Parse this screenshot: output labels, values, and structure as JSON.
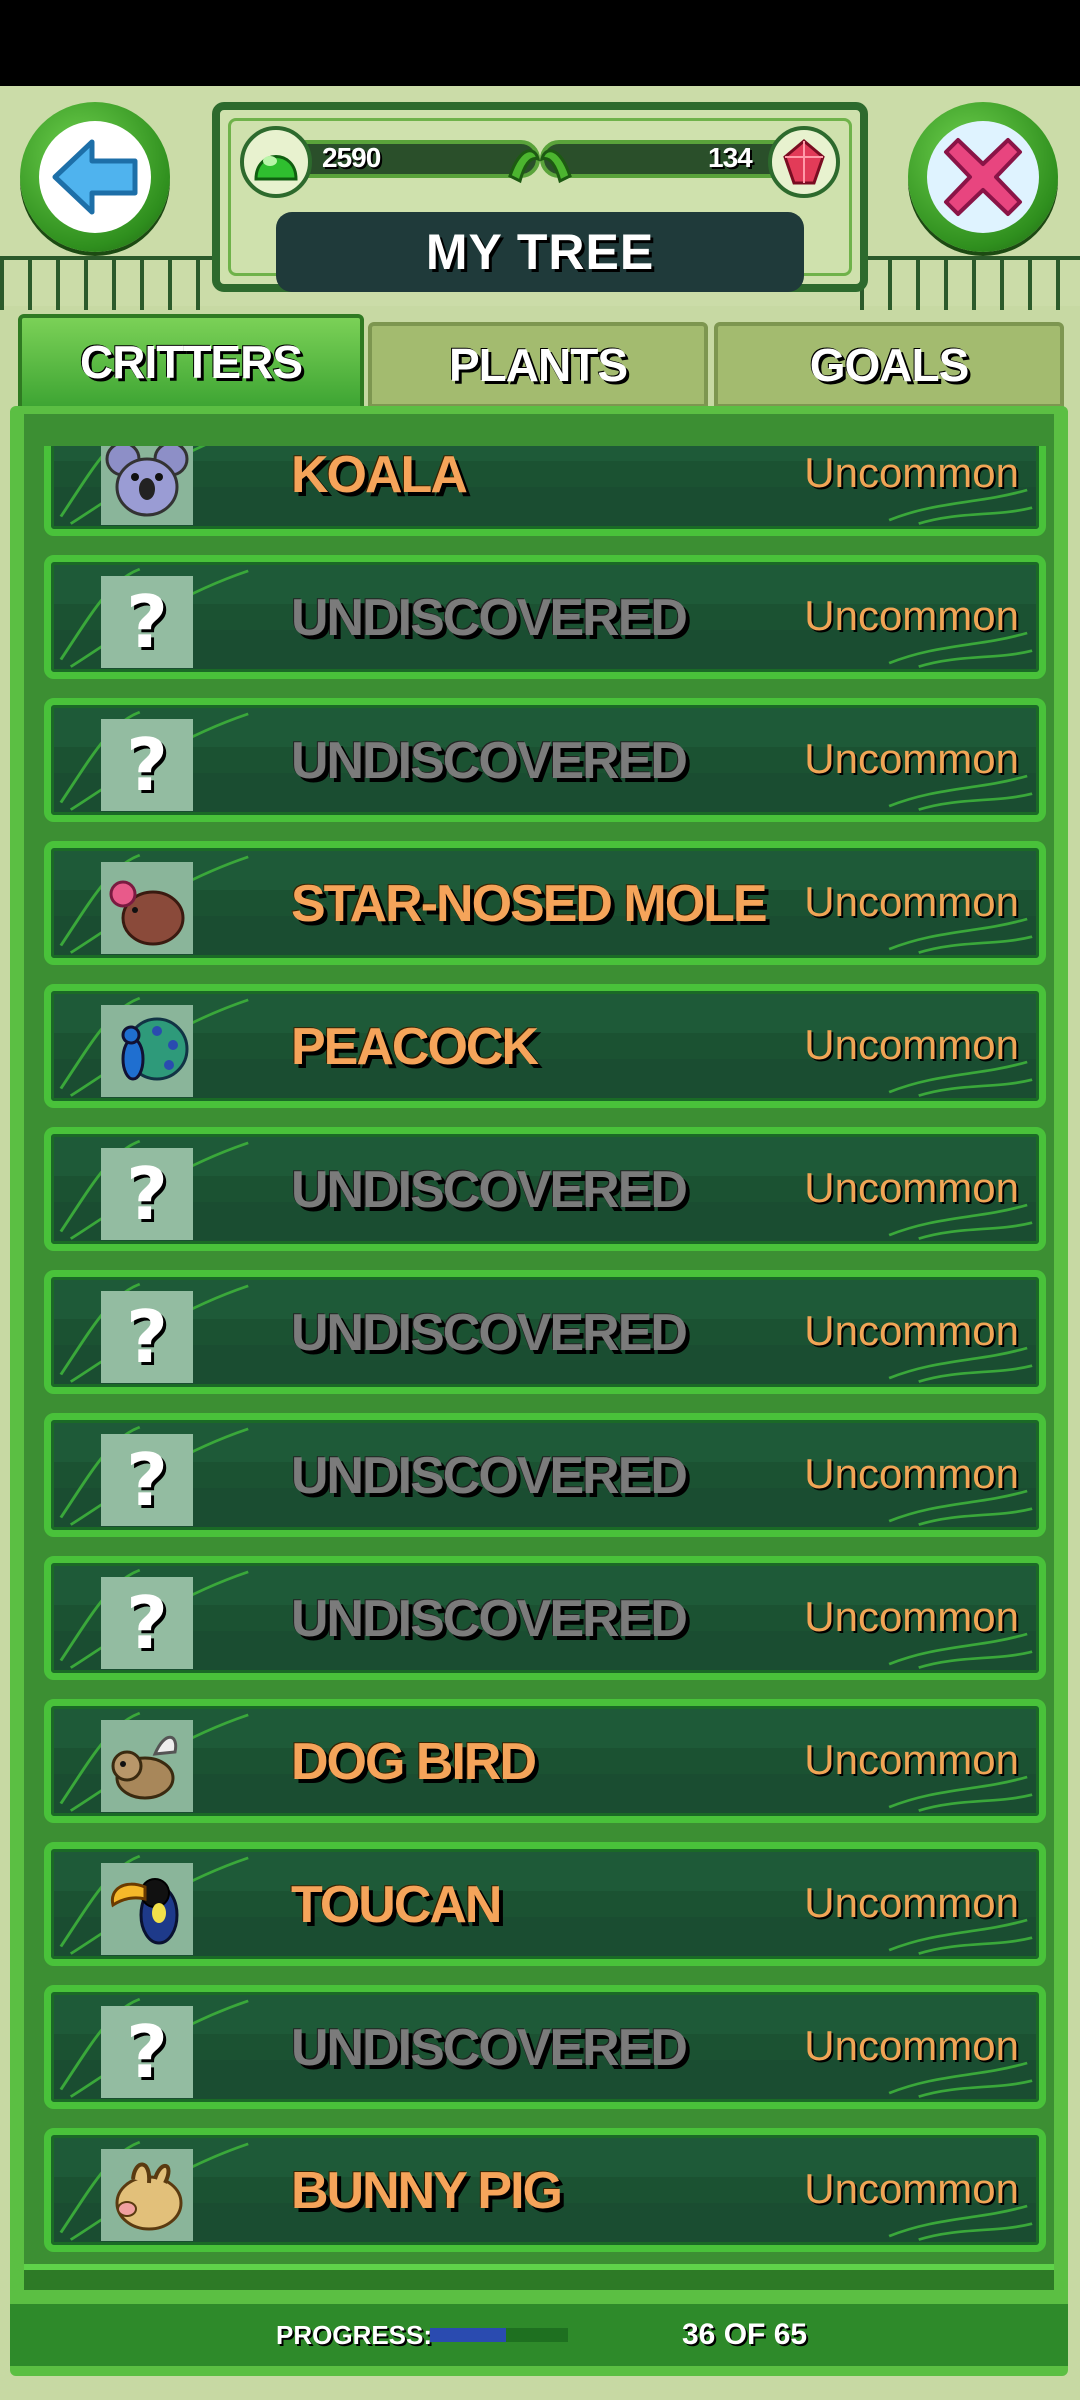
{
  "header": {
    "title": "MY TREE",
    "currency": {
      "gems_green": "2590",
      "gems_red": "134"
    }
  },
  "tabs": [
    {
      "label": "CRITTERS",
      "active": true
    },
    {
      "label": "PLANTS",
      "active": false
    },
    {
      "label": "GOALS",
      "active": false
    }
  ],
  "critters": [
    {
      "name": "KOALA",
      "rarity": "Uncommon",
      "icon": "koala-icon",
      "discovered": true
    },
    {
      "name": "UNDISCOVERED",
      "rarity": "Uncommon",
      "icon": "question-mark-icon",
      "discovered": false
    },
    {
      "name": "UNDISCOVERED",
      "rarity": "Uncommon",
      "icon": "question-mark-icon",
      "discovered": false
    },
    {
      "name": "STAR-NOSED MOLE",
      "rarity": "Uncommon",
      "icon": "star-nosed-mole-icon",
      "discovered": true
    },
    {
      "name": "PEACOCK",
      "rarity": "Uncommon",
      "icon": "peacock-icon",
      "discovered": true
    },
    {
      "name": "UNDISCOVERED",
      "rarity": "Uncommon",
      "icon": "question-mark-icon",
      "discovered": false
    },
    {
      "name": "UNDISCOVERED",
      "rarity": "Uncommon",
      "icon": "question-mark-icon",
      "discovered": false
    },
    {
      "name": "UNDISCOVERED",
      "rarity": "Uncommon",
      "icon": "question-mark-icon",
      "discovered": false
    },
    {
      "name": "UNDISCOVERED",
      "rarity": "Uncommon",
      "icon": "question-mark-icon",
      "discovered": false
    },
    {
      "name": "DOG BIRD",
      "rarity": "Uncommon",
      "icon": "dog-bird-icon",
      "discovered": true
    },
    {
      "name": "TOUCAN",
      "rarity": "Uncommon",
      "icon": "toucan-icon",
      "discovered": true
    },
    {
      "name": "UNDISCOVERED",
      "rarity": "Uncommon",
      "icon": "question-mark-icon",
      "discovered": false
    },
    {
      "name": "BUNNY PIG",
      "rarity": "Uncommon",
      "icon": "bunny-pig-icon",
      "discovered": true
    }
  ],
  "progress": {
    "label": "PROGRESS:",
    "count_text": "36 OF 65",
    "fraction": 0.5538
  },
  "colors": {
    "discovered_name": "#f5a45a",
    "undiscovered_name": "#7b7b7b",
    "row_border": "#49c23a",
    "row_bg": "#1e5a38"
  }
}
